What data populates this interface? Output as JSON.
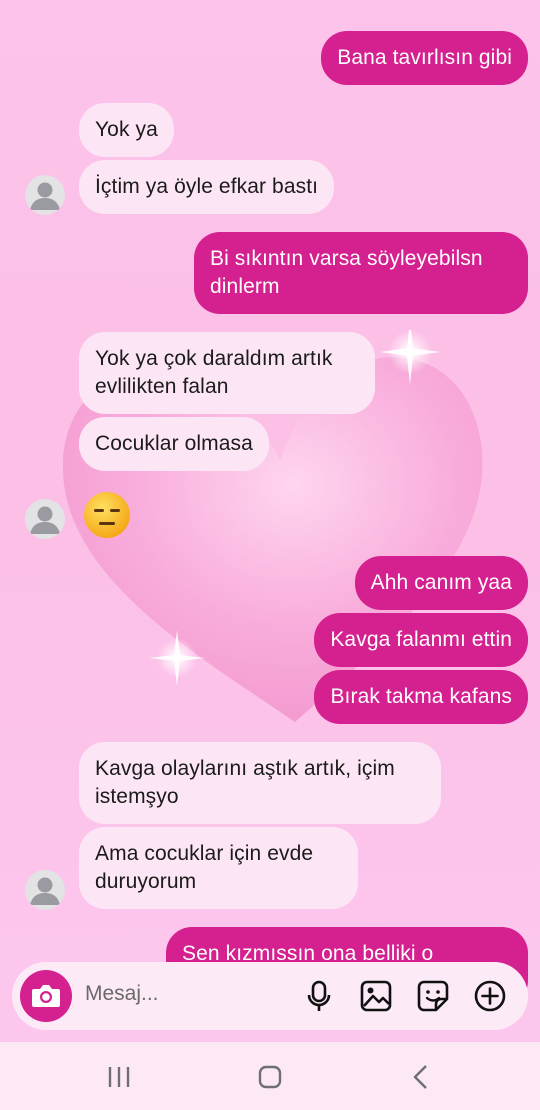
{
  "messages": [
    {
      "side": "out",
      "text": "Bana tavırlısın gibi"
    },
    {
      "side": "in",
      "text": "Yok ya"
    },
    {
      "side": "in",
      "text": "İçtim ya öyle efkar bastı"
    },
    {
      "side": "out",
      "line1": "Bi sıkıntın varsa söyleyebilsn",
      "line2": "dinlerm"
    },
    {
      "side": "in",
      "line1": "Yok ya çok daraldım artık",
      "line2": "evlilikten falan"
    },
    {
      "side": "in",
      "text": "Cocuklar olmasa"
    },
    {
      "side": "in",
      "emoji": "expressionless-face"
    },
    {
      "side": "out",
      "text": "Ahh canım yaa"
    },
    {
      "side": "out",
      "text": "Kavga falanmı ettin"
    },
    {
      "side": "out",
      "text": "Bırak takma kafans"
    },
    {
      "side": "in",
      "line1": "Kavga olaylarını aştık artık, içim",
      "line2": "istemşyo"
    },
    {
      "side": "in",
      "line1": "Ama cocuklar için evde",
      "line2": "duruyorum"
    },
    {
      "side": "out",
      "text": "Sen kızmıssın ona belliki o"
    }
  ],
  "composer": {
    "placeholder": "Mesaj...",
    "icons": [
      "camera-icon",
      "microphone-icon",
      "gallery-icon",
      "sticker-icon",
      "add-icon"
    ]
  },
  "navbar": {
    "icons": [
      "recents-icon",
      "home-icon",
      "back-icon"
    ]
  },
  "colors": {
    "outgoing": "#d5208f",
    "incoming": "#fce6f5",
    "background": "#fdc3ea"
  }
}
